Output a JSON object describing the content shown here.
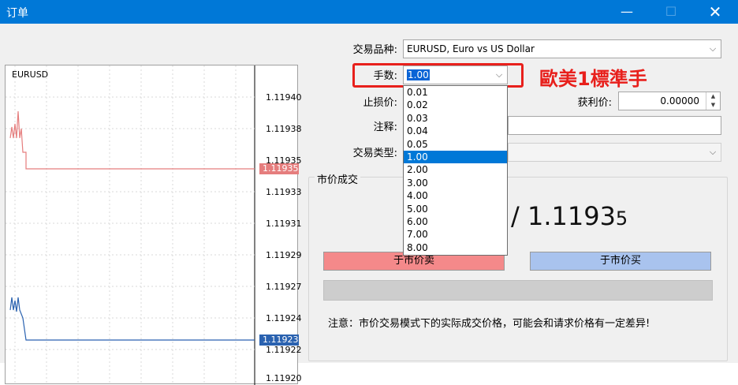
{
  "window": {
    "title": "订单",
    "min_icon": "minimize-icon",
    "max_icon": "maximize-icon",
    "close_icon": "close-icon"
  },
  "chart": {
    "symbol": "EURUSD",
    "price_labels": [
      "1.11940",
      "1.11938",
      "1.11935",
      "1.11933",
      "1.11931",
      "1.11929",
      "1.11927",
      "1.11924",
      "1.11922",
      "1.11920"
    ],
    "sell_tag": "1.11935",
    "buy_tag": "1.11923",
    "colors": {
      "sell": "#e57d7d",
      "buy": "#2a62b0"
    }
  },
  "form": {
    "symbol_label": "交易品种:",
    "symbol_value": "EURUSD, Euro vs US Dollar",
    "lots_label": "手数:",
    "lots_value": "1.00",
    "stoploss_label": "止损价:",
    "takeprofit_label": "获利价:",
    "takeprofit_value": "0.00000",
    "comment_label": "注释:",
    "type_label": "交易类型:"
  },
  "dropdown": {
    "options": [
      "0.01",
      "0.02",
      "0.03",
      "0.04",
      "0.05",
      "1.00",
      "2.00",
      "3.00",
      "4.00",
      "5.00",
      "6.00",
      "7.00",
      "8.00"
    ],
    "selected": "1.00"
  },
  "annotation": {
    "text": "歐美1標準手",
    "color": "#e8201c"
  },
  "market": {
    "group_title": "市价成交",
    "quote_main": "/ 1.1193",
    "quote_small": "5",
    "sell_button": "于市价卖",
    "buy_button": "于市价买",
    "note": "注意：市价交易模式下的实际成交价格，可能会和请求价格有一定差异!"
  }
}
